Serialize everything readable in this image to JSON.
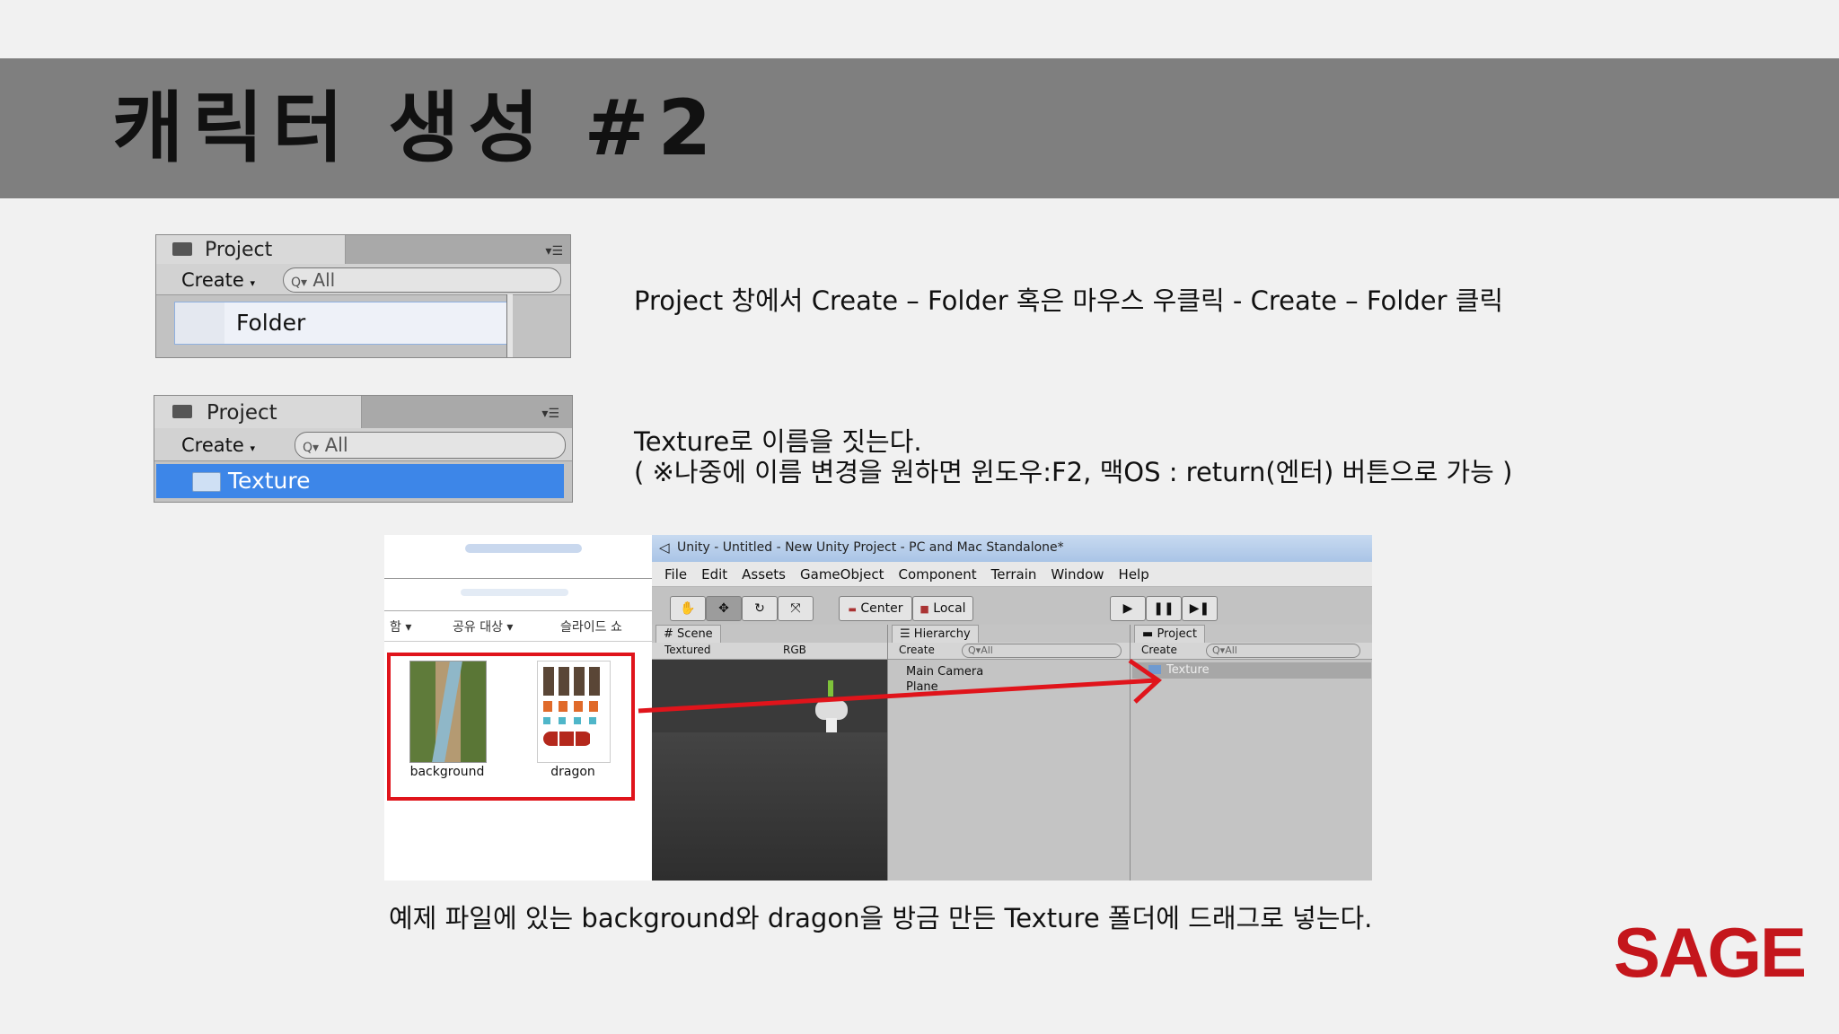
{
  "slide": {
    "title": "캐릭터 생성 #2",
    "logo": "SAGE"
  },
  "panel1": {
    "tab": "Project",
    "create": "Create",
    "search": "All",
    "item": "Folder"
  },
  "panel2": {
    "tab": "Project",
    "create": "Create",
    "search": "All",
    "item": "Texture"
  },
  "descriptions": {
    "step1": "Project 창에서 Create – Folder 혹은 마우스 우클릭 - Create – Folder 클릭",
    "step2_line1": "Texture로 이름을 짓는다.",
    "step2_line2": "( ※나중에 이름 변경을 원하면 윈도우:F2, 맥OS : return(엔터) 버튼으로 가능 )",
    "caption": "예제 파일에 있는 background와 dragon을 방금 만든 Texture 폴더에 드래그로 넣는다."
  },
  "explorer": {
    "toolbar": [
      "함 ▾",
      "공유 대상 ▾",
      "슬라이드 쇼"
    ],
    "files": [
      {
        "name": "background"
      },
      {
        "name": "dragon"
      }
    ]
  },
  "unity": {
    "window_title": "Unity - Untitled - New Unity Project - PC and Mac Standalone*",
    "menu": [
      "File",
      "Edit",
      "Assets",
      "GameObject",
      "Component",
      "Terrain",
      "Window",
      "Help"
    ],
    "pivot_center": "Center",
    "pivot_local": "Local",
    "scene_tab": "Scene",
    "scene_mode": "Textured",
    "scene_rgb": "RGB",
    "hierarchy_tab": "Hierarchy",
    "hierarchy_create": "Create",
    "hierarchy_search": "All",
    "hierarchy_items": [
      "Main Camera",
      "Plane"
    ],
    "project_tab": "Project",
    "project_create": "Create",
    "project_search": "All",
    "project_items": [
      "Texture"
    ]
  },
  "colors": {
    "title_band": "#7f7f7f",
    "selection_blue": "#3d86e8",
    "highlight_red": "#e0141b",
    "logo_red": "#c4161c"
  }
}
